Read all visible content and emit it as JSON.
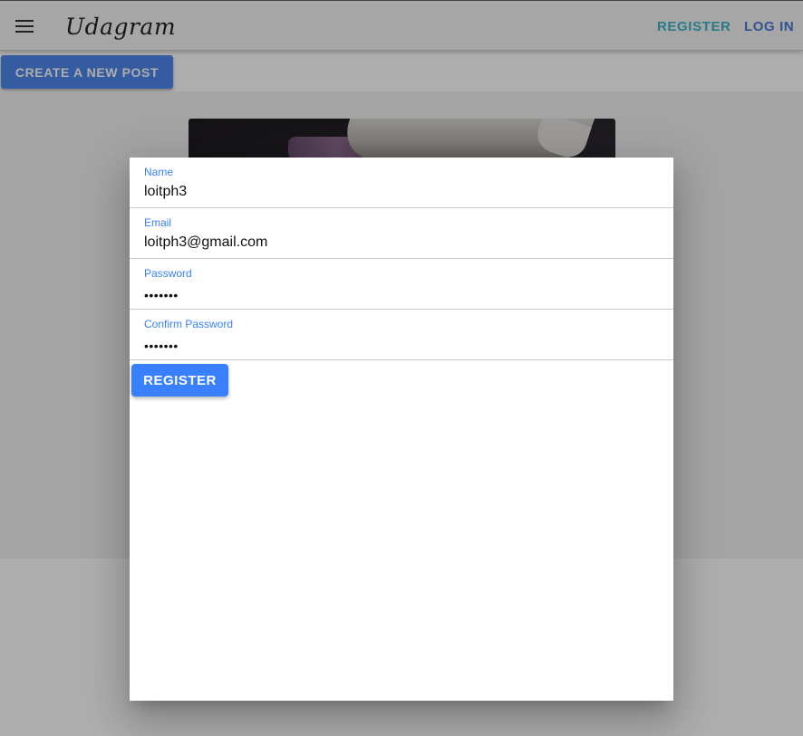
{
  "header": {
    "brand": "Udagram",
    "nav_register": "REGISTER",
    "nav_login": "LOG IN"
  },
  "feed": {
    "create_post_label": "CREATE A NEW POST"
  },
  "register_modal": {
    "fields": [
      {
        "label": "Name",
        "value": "loitph3"
      },
      {
        "label": "Email",
        "value": "loitph3@gmail.com"
      },
      {
        "label": "Password",
        "value": "•••••••"
      },
      {
        "label": "Confirm Password",
        "value": "•••••••"
      }
    ],
    "submit_label": "REGISTER"
  },
  "colors": {
    "primary": "#3880ff",
    "register_link": "#3fb7c9",
    "login_link": "#4a7bd3"
  },
  "icons": {
    "menu": "menu-icon"
  }
}
